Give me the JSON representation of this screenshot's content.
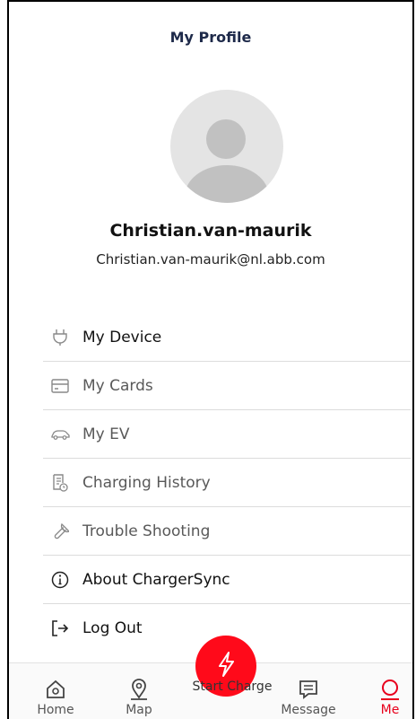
{
  "header": {
    "title": "My Profile"
  },
  "profile": {
    "name": "Christian.van-maurik",
    "email": "Christian.van-maurik@nl.abb.com"
  },
  "menu": [
    {
      "label": "My Device",
      "icon": "plug-icon"
    },
    {
      "label": "My Cards",
      "icon": "card-icon"
    },
    {
      "label": "My EV",
      "icon": "car-icon"
    },
    {
      "label": "Charging History",
      "icon": "history-icon"
    },
    {
      "label": "Trouble Shooting",
      "icon": "wrench-icon"
    },
    {
      "label": "About ChargerSync",
      "icon": "info-icon"
    },
    {
      "label": "Log Out",
      "icon": "logout-icon"
    }
  ],
  "tabbar": {
    "home": "Home",
    "map": "Map",
    "start_charge": "Start Charge",
    "message": "Message",
    "me": "Me"
  },
  "colors": {
    "accent": "#e8001c",
    "start_button": "#ff0a1a",
    "title": "#1e2a4a"
  }
}
